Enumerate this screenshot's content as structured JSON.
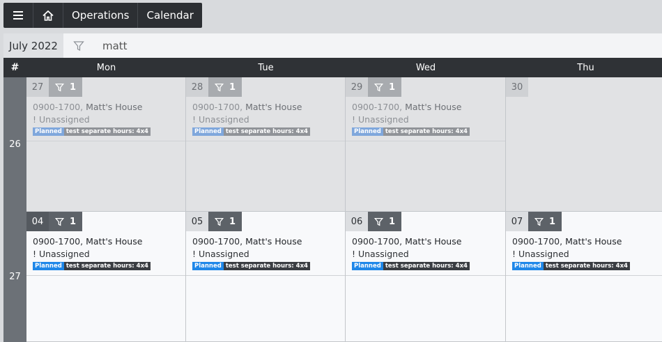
{
  "toolbar": {
    "menu_icon": "hamburger-icon",
    "home_icon": "home-icon",
    "breadcrumbs": [
      "Operations",
      "Calendar"
    ]
  },
  "subbar": {
    "month": "July 2022",
    "filter_icon": "filter-icon",
    "filter_value": "matt"
  },
  "header": {
    "week_symbol": "#",
    "days": [
      "Mon",
      "Tue",
      "Wed",
      "Thu"
    ]
  },
  "weeks": [
    {
      "week": "26",
      "cells": [
        {
          "day": "27",
          "count": "1",
          "event": {
            "time": "0900-1700, ",
            "location": "Matt's House",
            "assignee": "! Unassigned",
            "status": "Planned",
            "note": "test separate hours: 4x4"
          }
        },
        {
          "day": "28",
          "count": "1",
          "event": {
            "time": "0900-1700, ",
            "location": "Matt's House",
            "assignee": "! Unassigned",
            "status": "Planned",
            "note": "test separate hours: 4x4"
          }
        },
        {
          "day": "29",
          "count": "1",
          "event": {
            "time": "0900-1700, ",
            "location": "Matt's House",
            "assignee": "! Unassigned",
            "status": "Planned",
            "note": "test separate hours: 4x4"
          }
        },
        {
          "day": "30"
        }
      ]
    },
    {
      "week": "27",
      "cells": [
        {
          "day": "04",
          "count": "1",
          "event": {
            "time": "0900-1700, ",
            "location": "Matt's House",
            "assignee": "! Unassigned",
            "status": "Planned",
            "note": "test separate hours: 4x4"
          }
        },
        {
          "day": "05",
          "count": "1",
          "event": {
            "time": "0900-1700, ",
            "location": "Matt's House",
            "assignee": "! Unassigned",
            "status": "Planned",
            "note": "test separate hours: 4x4"
          }
        },
        {
          "day": "06",
          "count": "1",
          "event": {
            "time": "0900-1700, ",
            "location": "Matt's House",
            "assignee": "! Unassigned",
            "status": "Planned",
            "note": "test separate hours: 4x4"
          }
        },
        {
          "day": "07",
          "count": "1",
          "event": {
            "time": "0900-1700, ",
            "location": "Matt's House",
            "assignee": "! Unassigned",
            "status": "Planned",
            "note": "test separate hours: 4x4"
          }
        }
      ]
    }
  ]
}
